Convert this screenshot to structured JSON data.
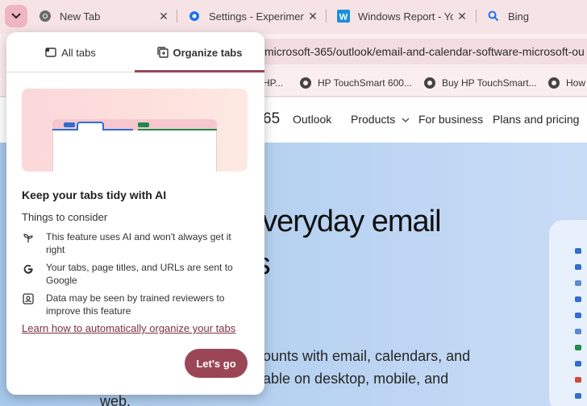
{
  "colors": {
    "accent": "#9b4656",
    "tabstrip": "#f6e3e6",
    "hero_blue": "#b9d3f2"
  },
  "tabs": [
    {
      "title": "New Tab",
      "icon": "chrome-icon"
    },
    {
      "title": "Settings - Experiment",
      "icon": "gear-icon"
    },
    {
      "title": "Windows Report - Yo",
      "icon": "windows-report-icon"
    },
    {
      "title": "Bing",
      "icon": "search-icon"
    }
  ],
  "omnibox": {
    "url": "microsoft-365/outlook/email-and-calendar-software-microsoft-ou"
  },
  "bookmarks": [
    {
      "label": "HP..."
    },
    {
      "label": "HP TouchSmart 600..."
    },
    {
      "label": "Buy HP TouchSmart..."
    },
    {
      "label": "How"
    }
  ],
  "site": {
    "brand_suffix": "65",
    "nav": [
      "Outlook",
      "Products",
      "For business",
      "Plans and pricing"
    ],
    "hero_title_1": "everyday email",
    "hero_title_2": "rs",
    "hero_lines": [
      "ounts with email, calendars, and",
      "able on desktop, mobile, and",
      "web."
    ]
  },
  "popup": {
    "tab_all": "All tabs",
    "tab_organize": "Organize tabs",
    "title": "Keep your tabs tidy with AI",
    "subtitle": "Things to consider",
    "items": [
      {
        "text": "This feature uses AI and won't always get it right",
        "icon": "sprout-icon"
      },
      {
        "text": "Your tabs, page titles, and URLs are sent to Google",
        "icon": "google-icon"
      },
      {
        "text": "Data may be seen by trained reviewers to improve this feature",
        "icon": "reviewer-icon"
      }
    ],
    "link": "Learn how to automatically organize your tabs",
    "button": "Let's go"
  }
}
